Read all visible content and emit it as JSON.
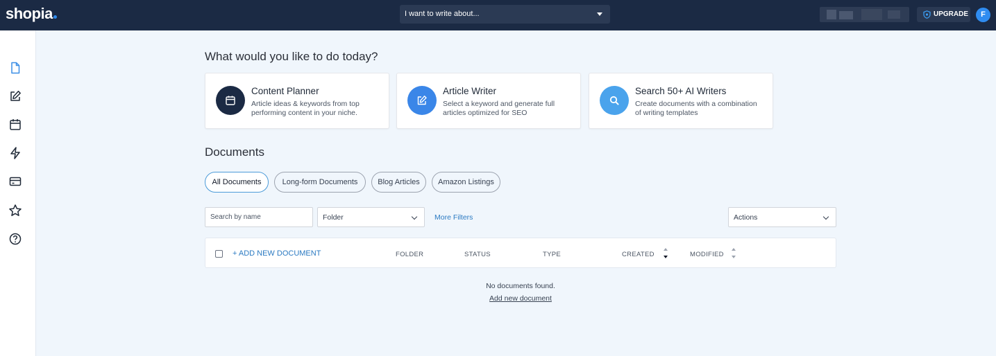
{
  "header": {
    "logo": "shopia",
    "write_select": {
      "value": "I want to write about..."
    },
    "upgrade_label": "UPGRADE",
    "avatar_initial": "F"
  },
  "sidebar": {
    "icons": [
      "document-icon",
      "edit-icon",
      "calendar-icon",
      "lightning-icon",
      "credit-card-icon",
      "star-icon",
      "help-icon"
    ]
  },
  "main": {
    "heading": "What would you like to do today?",
    "cards": [
      {
        "title": "Content Planner",
        "desc": "Article ideas & keywords from top performing content in your niche.",
        "icon": "calendar-icon",
        "color": "#1b2a44"
      },
      {
        "title": "Article Writer",
        "desc": "Select a keyword and generate full articles optimized for SEO",
        "icon": "edit-icon",
        "color": "#3a86e8"
      },
      {
        "title": "Search 50+ AI Writers",
        "desc": "Create documents with a combination of writing templates",
        "icon": "search-icon",
        "color": "#4aa3ec"
      }
    ],
    "documents_title": "Documents",
    "tabs": [
      {
        "label": "All Documents",
        "active": true
      },
      {
        "label": "Long-form Documents",
        "active": false
      },
      {
        "label": "Blog Articles",
        "active": false
      },
      {
        "label": "Amazon Listings",
        "active": false
      }
    ],
    "filters": {
      "search_placeholder": "Search by name",
      "folder_value": "Folder",
      "more_filters": "More Filters",
      "actions_value": "Actions"
    },
    "table": {
      "add_label": "+ ADD NEW DOCUMENT",
      "columns": [
        "FOLDER",
        "STATUS",
        "TYPE",
        "CREATED",
        "MODIFIED"
      ]
    },
    "empty_message": "No documents found.",
    "add_link": "Add new document"
  },
  "colors": {
    "topbar": "#1b2a44",
    "accent": "#2f8cf0",
    "link": "#2b7ac2"
  }
}
